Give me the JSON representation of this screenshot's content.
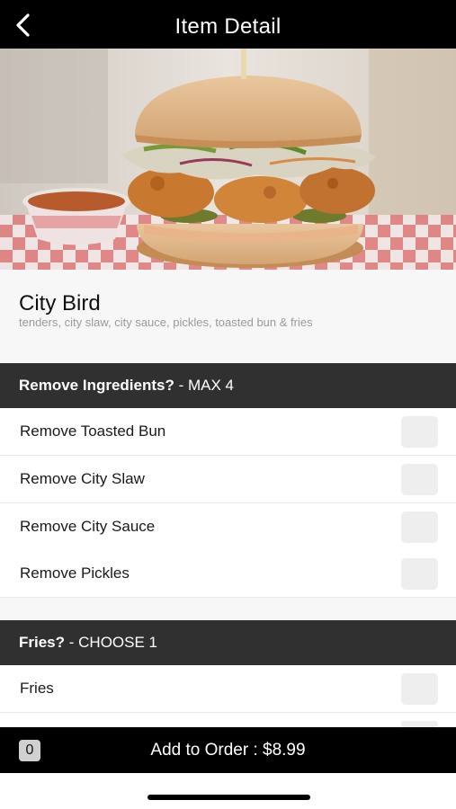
{
  "header": {
    "title": "Item Detail",
    "back_icon": "chevron-left-icon"
  },
  "item": {
    "name": "City Bird",
    "description": "tenders, city slaw, city sauce, pickles, toasted bun & fries"
  },
  "sections": [
    {
      "title": "Remove Ingredients?",
      "rule": " - MAX 4",
      "options": [
        {
          "label": "Remove Toasted Bun",
          "checked": false
        },
        {
          "label": "Remove City Slaw",
          "checked": false
        },
        {
          "label": "Remove City Sauce",
          "checked": false
        },
        {
          "label": "Remove Pickles",
          "checked": false
        }
      ]
    },
    {
      "title": "Fries?",
      "rule": " - CHOOSE 1",
      "options": [
        {
          "label": "Fries",
          "checked": false
        }
      ]
    }
  ],
  "order_bar": {
    "quantity": "0",
    "label": "Add to Order : $8.99"
  },
  "colors": {
    "header": "#000000",
    "section_header": "#303030",
    "checkbox": "#eeeeee",
    "description": "#9a9a9a"
  }
}
